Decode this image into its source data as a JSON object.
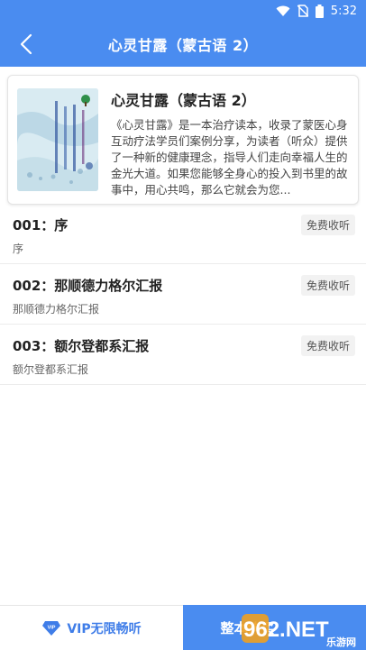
{
  "status_bar": {
    "time": "5:32"
  },
  "header": {
    "title": "心灵甘露（蒙古语 2）"
  },
  "book": {
    "title": "心灵甘露（蒙古语 2）",
    "description": "《心灵甘露》是一本治疗读本，收录了蒙医心身互动疗法学员们案例分享，为读者（听众）提供了一种新的健康理念，指导人们走向幸福人生的金光大道。如果您能够全身心的投入到书里的故事中，用心共鸣，那么它就会为您..."
  },
  "chapters": [
    {
      "title": "001：序",
      "subtitle": "序",
      "badge": "免费收听"
    },
    {
      "title": "002：那顺德力格尔汇报",
      "subtitle": "那顺德力格尔汇报",
      "badge": "免费收听"
    },
    {
      "title": "003：额尔登都系汇报",
      "subtitle": "额尔登都系汇报",
      "badge": "免费收听"
    }
  ],
  "bottom": {
    "vip_badge": "VIP",
    "vip_label": "VIP无限畅听",
    "buy_label": "整本购买"
  },
  "watermark": {
    "text": "962.NET",
    "subtext": "乐游网"
  },
  "colors": {
    "primary": "#4a8cf0",
    "vip": "#3f7de8"
  }
}
